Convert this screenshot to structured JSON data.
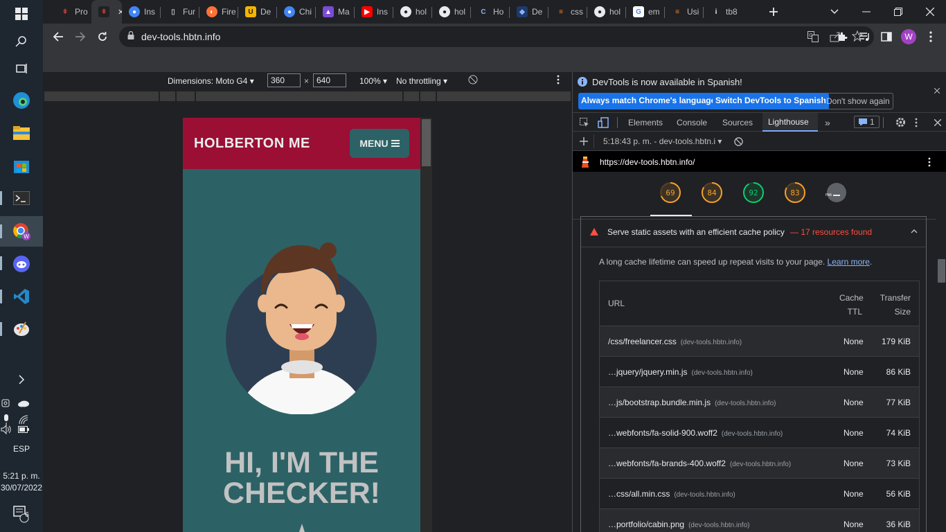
{
  "taskbar": {
    "lang": "ESP",
    "time": "5:21 p. m.",
    "date": "30/07/2022",
    "notif_count": "6"
  },
  "tabs": [
    {
      "label": "Pro",
      "favicon": "holberton-icon"
    },
    {
      "label": "",
      "favicon": "holberton-icon",
      "active": true
    },
    {
      "label": "Ins",
      "favicon": "chrome-icon"
    },
    {
      "label": "Fur",
      "favicon": "book-icon"
    },
    {
      "label": "Fire",
      "favicon": "firefox-icon"
    },
    {
      "label": "De",
      "favicon": "u-icon"
    },
    {
      "label": "Chi",
      "favicon": "chrome-icon"
    },
    {
      "label": "Ma",
      "favicon": "rocket-icon"
    },
    {
      "label": "Ins",
      "favicon": "youtube-icon"
    },
    {
      "label": "hol",
      "favicon": "github-icon"
    },
    {
      "label": "hol",
      "favicon": "github-icon"
    },
    {
      "label": "Ho",
      "favicon": "code-icon"
    },
    {
      "label": "De",
      "favicon": "shield-icon"
    },
    {
      "label": "css",
      "favicon": "stackoverflow-icon"
    },
    {
      "label": "hol",
      "favicon": "github-icon"
    },
    {
      "label": "em",
      "favicon": "google-icon"
    },
    {
      "label": "Usi",
      "favicon": "stackoverflow-icon"
    },
    {
      "label": "tb8",
      "favicon": "info-icon"
    }
  ],
  "address": {
    "url": "dev-tools.hbtn.info"
  },
  "profile": {
    "initial": "W"
  },
  "device_toolbar": {
    "dimensions_label": "Dimensions: Moto G4",
    "width": "360",
    "height": "640",
    "zoom": "100%",
    "throttling": "No throttling"
  },
  "site": {
    "brand": "HOLBERTON ME",
    "menu_label": "MENU",
    "hero_title_1": "HI, I'M THE",
    "hero_title_2": "CHECKER!"
  },
  "devtools": {
    "info_message": "DevTools is now available in Spanish!",
    "btn_match": "Always match Chrome's language",
    "btn_switch": "Switch DevTools to Spanish",
    "btn_dismiss": "Don't show again",
    "tabs": [
      "Elements",
      "Console",
      "Sources",
      "Lighthouse"
    ],
    "issues_count": "1",
    "report_time": "5:18:43 p. m. - dev-tools.hbtn.i",
    "report_url": "https://dev-tools.hbtn.info/",
    "scores": [
      {
        "value": "69",
        "color": "#f4a12c",
        "fraction": 0.69
      },
      {
        "value": "84",
        "color": "#f4a12c",
        "fraction": 0.84
      },
      {
        "value": "92",
        "color": "#0cce6b",
        "fraction": 0.92
      },
      {
        "value": "83",
        "color": "#f4a12c",
        "fraction": 0.83
      },
      {
        "value": "PWA",
        "color": "#9aa0a6",
        "fraction": 0
      }
    ],
    "audit": {
      "title": "Serve static assets with an efficient cache policy",
      "summary": "— 17 resources found",
      "description": "A long cache lifetime can speed up repeat visits to your page.",
      "learn_more": "Learn more",
      "col_url": "URL",
      "col_ttl_1": "Cache",
      "col_ttl_2": "TTL",
      "col_size_1": "Transfer",
      "col_size_2": "Size",
      "rows": [
        {
          "url": "/css/freelancer.css",
          "host": "(dev-tools.hbtn.info)",
          "ttl": "None",
          "size": "179 KiB"
        },
        {
          "url": "…jquery/jquery.min.js",
          "host": "(dev-tools.hbtn.info)",
          "ttl": "None",
          "size": "86 KiB"
        },
        {
          "url": "…js/bootstrap.bundle.min.js",
          "host": "(dev-tools.hbtn.info)",
          "ttl": "None",
          "size": "77 KiB"
        },
        {
          "url": "…webfonts/fa-solid-900.woff2",
          "host": "(dev-tools.hbtn.info)",
          "ttl": "None",
          "size": "74 KiB"
        },
        {
          "url": "…webfonts/fa-brands-400.woff2",
          "host": "(dev-tools.hbtn.info)",
          "ttl": "None",
          "size": "73 KiB"
        },
        {
          "url": "…css/all.min.css",
          "host": "(dev-tools.hbtn.info)",
          "ttl": "None",
          "size": "56 KiB"
        },
        {
          "url": "…portfolio/cabin.png",
          "host": "(dev-tools.hbtn.info)",
          "ttl": "None",
          "size": "36 KiB"
        }
      ]
    }
  }
}
